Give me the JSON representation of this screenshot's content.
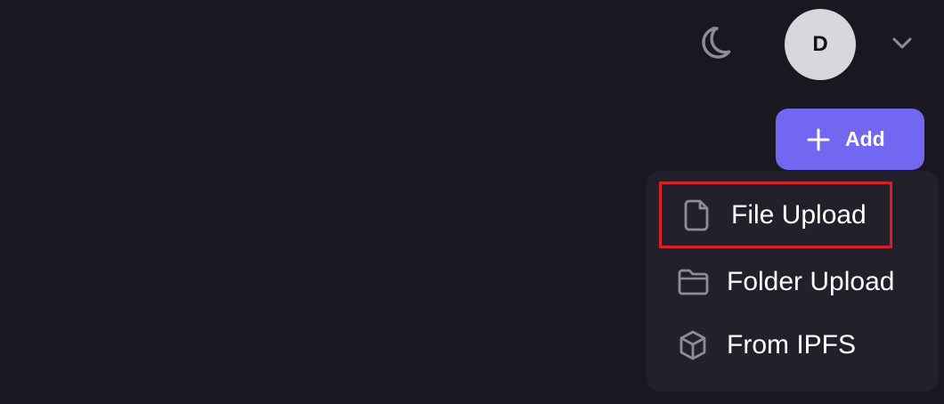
{
  "header": {
    "theme_icon": "moon-icon",
    "avatar_initial": "D",
    "chevron_icon": "chevron-down-icon"
  },
  "actions": {
    "add_label": "Add",
    "add_icon": "plus-icon"
  },
  "menu": {
    "items": [
      {
        "label": "File Upload",
        "icon": "file-icon"
      },
      {
        "label": "Folder Upload",
        "icon": "folder-icon"
      },
      {
        "label": "From IPFS",
        "icon": "cube-icon"
      }
    ]
  },
  "colors": {
    "background": "#1a1720",
    "menu_background": "#23202b",
    "accent": "#7167f0",
    "highlight_border": "#d71f28",
    "icon_muted": "#8f8c96",
    "avatar_bg": "#d7d8dc"
  }
}
